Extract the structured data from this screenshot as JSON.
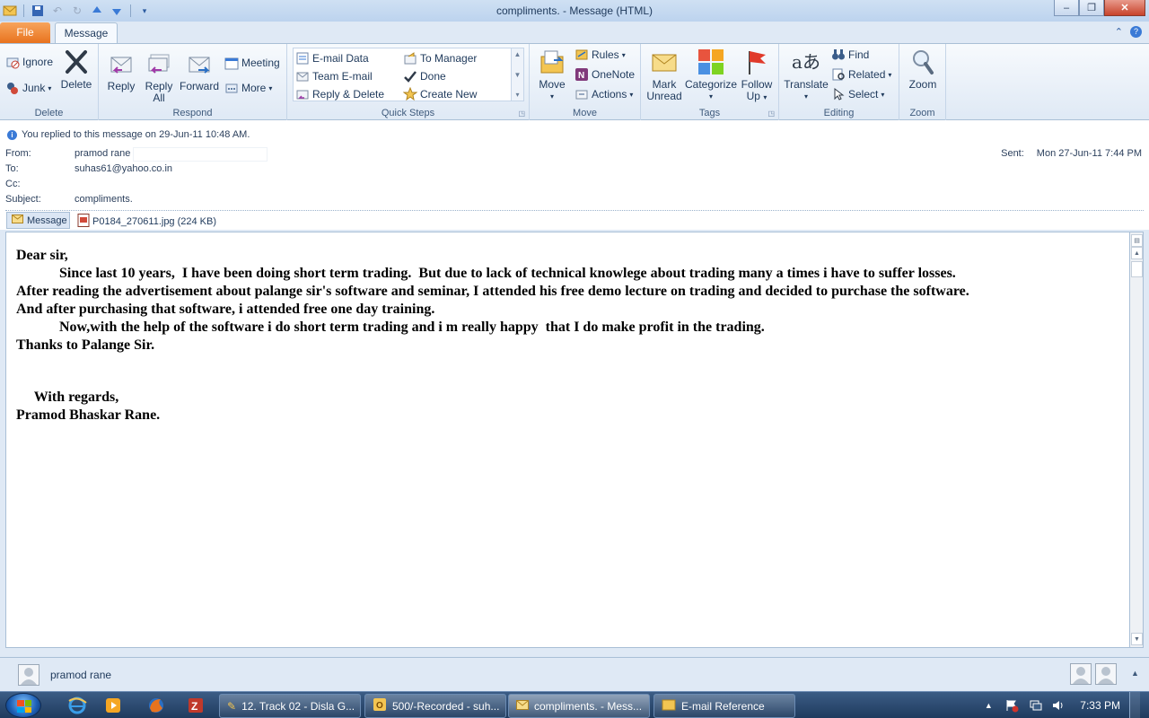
{
  "window": {
    "title": "compliments.  -  Message (HTML)",
    "minimize": "–",
    "restore": "❐",
    "close": "✕"
  },
  "tabs": {
    "file": "File",
    "message": "Message"
  },
  "ribbon": {
    "delete_group": {
      "label": "Delete",
      "ignore": "Ignore",
      "junk": "Junk",
      "delete": "Delete"
    },
    "respond_group": {
      "label": "Respond",
      "reply": "Reply",
      "reply_all_1": "Reply",
      "reply_all_2": "All",
      "forward": "Forward",
      "meeting": "Meeting",
      "more": "More"
    },
    "quicksteps_group": {
      "label": "Quick Steps",
      "items": [
        "E-mail Data",
        "To Manager",
        "Team E-mail",
        "Done",
        "Reply & Delete",
        "Create New"
      ]
    },
    "move_group": {
      "label": "Move",
      "move": "Move",
      "rules": "Rules",
      "onenote": "OneNote",
      "actions": "Actions"
    },
    "tags_group": {
      "label": "Tags",
      "mark_1": "Mark",
      "mark_2": "Unread",
      "categorize": "Categorize",
      "follow_1": "Follow",
      "follow_2": "Up"
    },
    "editing_group": {
      "label": "Editing",
      "translate": "Translate",
      "find": "Find",
      "related": "Related",
      "select": "Select"
    },
    "zoom_group": {
      "label": "Zoom",
      "zoom": "Zoom"
    }
  },
  "header": {
    "info": "You replied to this message on 29-Jun-11 10:48 AM.",
    "from_label": "From:",
    "from_value": "pramod rane",
    "to_label": "To:",
    "to_value": "suhas61@yahoo.co.in",
    "cc_label": "Cc:",
    "subject_label": "Subject:",
    "subject_value": "compliments.",
    "sent_label": "Sent:",
    "sent_value": "Mon 27-Jun-11 7:44 PM",
    "message_tab": "Message",
    "attachment": "P0184_270611.jpg (224 KB)"
  },
  "body": {
    "lines": [
      "Dear sir,",
      "            Since last 10 years,  I have been doing short term trading.  But due to lack of technical knowlege about trading many a times i have to suffer losses.",
      "After reading the advertisement about palange sir's software and seminar, I attended his free demo lecture on trading and decided to purchase the software.",
      "And after purchasing that software, i attended free one day training.",
      "            Now,with the help of the software i do short term trading and i m really happy  that I do make profit in the trading.",
      "Thanks to Palange Sir.",
      "     With regards,",
      "Pramod Bhaskar Rane."
    ]
  },
  "people_pane": {
    "name": "pramod rane"
  },
  "taskbar": {
    "tasks": [
      "12. Track 02 - Disla G...",
      "500/-Recorded - suh...",
      "compliments. - Mess...",
      "E-mail Reference"
    ],
    "time": "7:33 PM"
  },
  "colors": {
    "file_tab": "#e8731e",
    "ribbon_bg": "#dfe9f5",
    "taskbar": "#1f3b5e"
  }
}
